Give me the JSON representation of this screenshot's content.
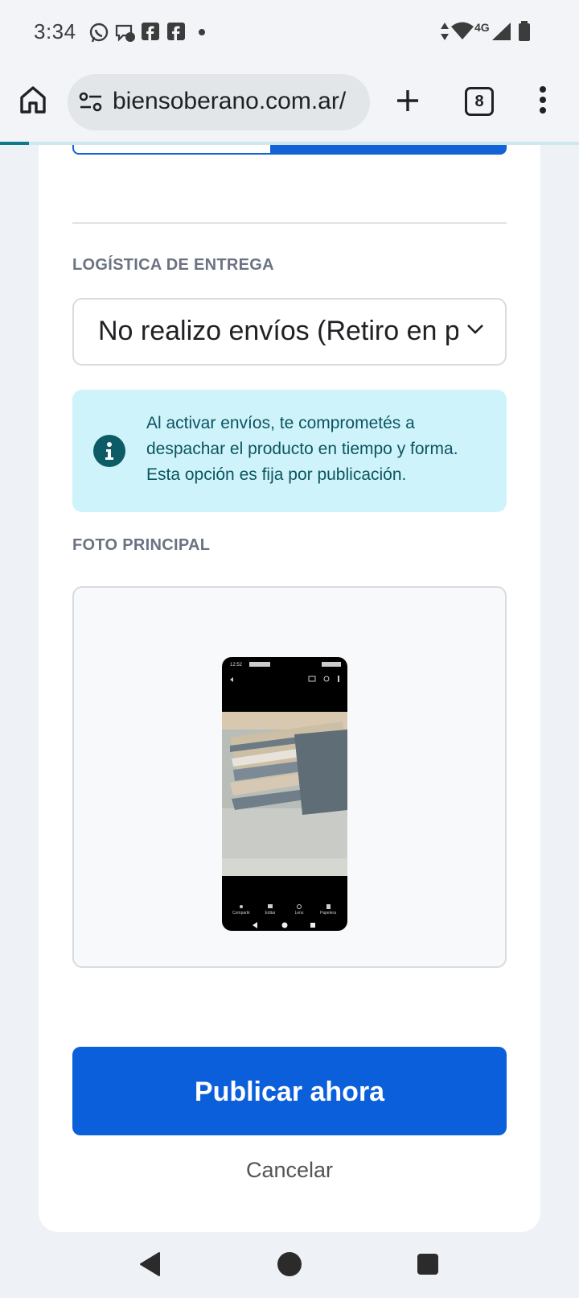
{
  "status_bar": {
    "time": "3:34",
    "notification_icons": [
      "whatsapp-icon",
      "messenger-icon",
      "facebook-icon",
      "facebook-icon",
      "dot-icon"
    ],
    "network_label": "4G",
    "status_icons": [
      "data-arrows-icon",
      "wifi-icon",
      "signal-icon",
      "battery-icon"
    ]
  },
  "browser": {
    "url": "biensoberano.com.ar/",
    "tab_count": "8"
  },
  "form": {
    "logistics_label": "LOGÍSTICA DE ENTREGA",
    "logistics_value": "No realizo envíos (Retiro en persona)",
    "info_text": "Al activar envíos, te comprometés a despachar el producto en tiempo y forma. Esta opción es fija por publicación.",
    "photo_label": "FOTO PRINCIPAL",
    "publish_label": "Publicar ahora",
    "cancel_label": "Cancelar"
  },
  "thumbnail": {
    "status_time": "12:52",
    "actions": [
      "Compartir",
      "Editar",
      "Lens",
      "Papelera"
    ]
  },
  "colors": {
    "primary": "#0c5fdb",
    "info_bg": "#cff3fa",
    "info_icon": "#0c5b66"
  }
}
